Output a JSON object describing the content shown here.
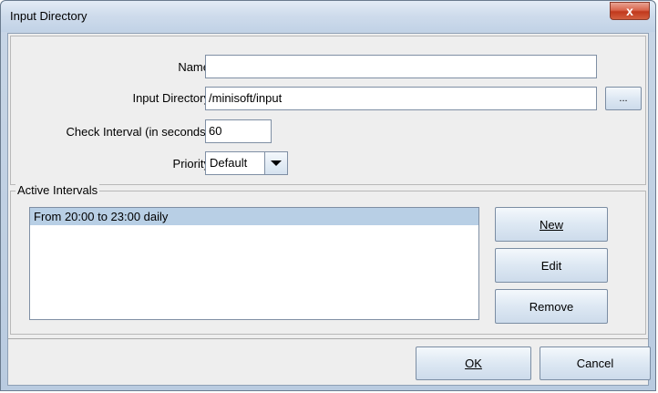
{
  "window": {
    "title": "Input Directory",
    "close_glyph": "x"
  },
  "form": {
    "name_label": "Name",
    "name_value": "",
    "input_dir_label": "Input Directory",
    "input_dir_value": "/minisoft/input",
    "browse_label": "...",
    "check_interval_label": "Check Interval (in seconds)",
    "check_interval_value": "60",
    "priority_label": "Priority",
    "priority_value": "Default"
  },
  "intervals": {
    "title": "Active Intervals",
    "items": [
      "From 20:00 to 23:00 daily"
    ],
    "new_label": "New",
    "edit_label": "Edit",
    "remove_label": "Remove"
  },
  "footer": {
    "ok_label": "OK",
    "cancel_label": "Cancel"
  }
}
